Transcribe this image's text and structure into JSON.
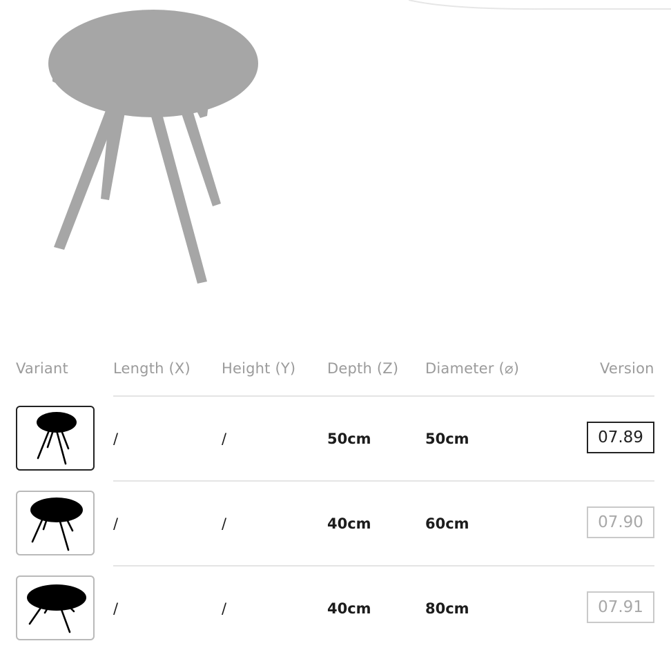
{
  "product": {
    "image_name": "round-side-table-grey-render"
  },
  "table": {
    "headers": {
      "variant": "Variant",
      "length": "Length (X)",
      "height": "Height (Y)",
      "depth": "Depth (Z)",
      "diameter": "Diameter (⌀)",
      "version": "Version"
    },
    "rows": [
      {
        "length": "/",
        "height": "/",
        "depth": "50cm",
        "diameter": "50cm",
        "version": "07.89",
        "selected": true,
        "thumbnail_icon": "small-round-table-icon"
      },
      {
        "length": "/",
        "height": "/",
        "depth": "40cm",
        "diameter": "60cm",
        "version": "07.90",
        "selected": false,
        "thumbnail_icon": "medium-round-table-icon"
      },
      {
        "length": "/",
        "height": "/",
        "depth": "40cm",
        "diameter": "80cm",
        "version": "07.91",
        "selected": false,
        "thumbnail_icon": "large-round-table-icon"
      }
    ]
  },
  "colors": {
    "product_grey": "#a6a6a6",
    "selected_border": "#222222",
    "unselected_border": "#b9b9b9",
    "header_text": "#9b9b9b"
  }
}
